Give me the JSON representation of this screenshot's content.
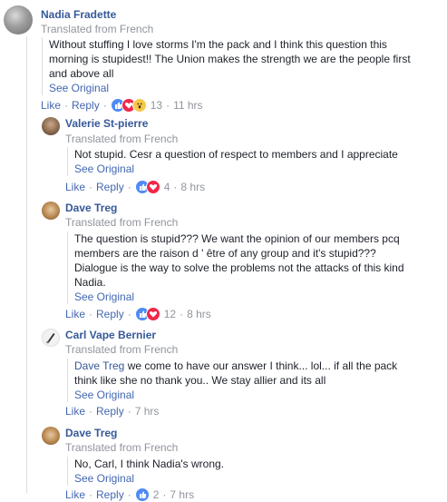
{
  "comments": [
    {
      "author": "Nadia Fradette",
      "translated": "Translated from French",
      "lines": [
        "Without stuffing I love storms I'm the pack and I think this question this",
        "morning is stupidest!! The Union makes the strength we are the people first",
        "and above all"
      ],
      "see_original": "See Original",
      "like": "Like",
      "reply": "Reply",
      "reactions": [
        "like-icon",
        "love-icon",
        "wow-icon"
      ],
      "reaction_count": "13",
      "time": "11 hrs"
    },
    {
      "author": "Valerie St-pierre",
      "translated": "Translated from French",
      "lines": [
        "Not stupid. Cesr a question of respect to members and I appreciate"
      ],
      "see_original": "See Original",
      "like": "Like",
      "reply": "Reply",
      "reactions": [
        "like-icon",
        "love-icon"
      ],
      "reaction_count": "4",
      "time": "8 hrs"
    },
    {
      "author": "Dave Treg",
      "translated": "Translated from French",
      "lines": [
        "The question is stupid??? We want the opinion of our members pcq",
        "members are the raison d ' être of any group and it's stupid???",
        "Dialogue is the way to solve the problems not the attacks of this kind",
        "Nadia."
      ],
      "see_original": "See Original",
      "like": "Like",
      "reply": "Reply",
      "reactions": [
        "like-icon",
        "love-icon"
      ],
      "reaction_count": "12",
      "time": "8 hrs"
    },
    {
      "author": "Carl Vape Bernier",
      "translated": "Translated from French",
      "mention": "Dave Treg",
      "lines": [
        " we come to have our answer I think... lol... if all the pack",
        "think like she no thank you.. We stay allier and its all"
      ],
      "see_original": "See Original",
      "like": "Like",
      "reply": "Reply",
      "time": "7 hrs"
    },
    {
      "author": "Dave Treg",
      "translated": "Translated from French",
      "lines": [
        "No, Carl, I think Nadia's wrong."
      ],
      "see_original": "See Original",
      "like": "Like",
      "reply": "Reply",
      "reaction_count": "2",
      "time": "7 hrs"
    }
  ],
  "colors": {
    "link": "#4267b2",
    "name": "#365899",
    "meta": "#90949c",
    "text": "#1d2129"
  }
}
